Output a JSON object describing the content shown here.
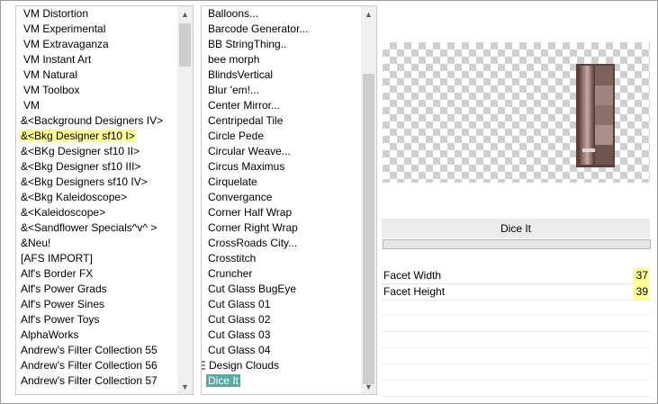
{
  "categories": {
    "items": [
      {
        "label": "VM Distortion"
      },
      {
        "label": "VM Experimental"
      },
      {
        "label": "VM Extravaganza"
      },
      {
        "label": "VM Instant Art"
      },
      {
        "label": "VM Natural"
      },
      {
        "label": "VM Toolbox"
      },
      {
        "label": "VM"
      },
      {
        "label": "&<Background Designers IV>"
      },
      {
        "label": "&<Bkg Designer sf10 I>",
        "selected": true
      },
      {
        "label": "&<BKg Designer sf10 II>"
      },
      {
        "label": "&<Bkg Designer sf10 III>"
      },
      {
        "label": "&<Bkg Designers sf10 IV>"
      },
      {
        "label": "&<Bkg Kaleidoscope>"
      },
      {
        "label": "&<Kaleidoscope>"
      },
      {
        "label": "&<Sandflower Specials^v^ >"
      },
      {
        "label": "&Neu!"
      },
      {
        "label": "[AFS IMPORT]"
      },
      {
        "label": "Alf's Border FX"
      },
      {
        "label": "Alf's Power Grads"
      },
      {
        "label": "Alf's Power Sines"
      },
      {
        "label": "Alf's Power Toys"
      },
      {
        "label": "AlphaWorks"
      },
      {
        "label": "Andrew's Filter Collection 55"
      },
      {
        "label": "Andrew's Filter Collection 56"
      },
      {
        "label": "Andrew's Filter Collection 57"
      }
    ]
  },
  "filters": {
    "items": [
      {
        "label": "Balloons..."
      },
      {
        "label": "Barcode Generator..."
      },
      {
        "label": "BB StringThing.."
      },
      {
        "label": "bee morph"
      },
      {
        "label": "BlindsVertical"
      },
      {
        "label": "Blur 'em!..."
      },
      {
        "label": "Center Mirror..."
      },
      {
        "label": "Centripedal Tile"
      },
      {
        "label": "Circle Pede"
      },
      {
        "label": "Circular Weave..."
      },
      {
        "label": "Circus Maximus"
      },
      {
        "label": "Cirquelate"
      },
      {
        "label": "Convergance"
      },
      {
        "label": "Corner Half Wrap"
      },
      {
        "label": "Corner Right Wrap"
      },
      {
        "label": "CrossRoads City..."
      },
      {
        "label": "Crosstitch"
      },
      {
        "label": "Cruncher"
      },
      {
        "label": "Cut Glass  BugEye"
      },
      {
        "label": "Cut Glass 01"
      },
      {
        "label": "Cut Glass 02"
      },
      {
        "label": "Cut Glass 03"
      },
      {
        "label": "Cut Glass 04"
      },
      {
        "label": "Design Clouds"
      },
      {
        "label": "Dice It",
        "selected": true
      }
    ]
  },
  "filter_title": "Dice It",
  "params": [
    {
      "label": "Facet Width",
      "value": "37"
    },
    {
      "label": "Facet Height",
      "value": "39"
    }
  ],
  "icons": {
    "scroll_up": "chevron-up-icon",
    "scroll_down": "chevron-down-icon"
  },
  "colors": {
    "highlight": "#ffff99",
    "selected_filter": "#5aa9a2"
  }
}
